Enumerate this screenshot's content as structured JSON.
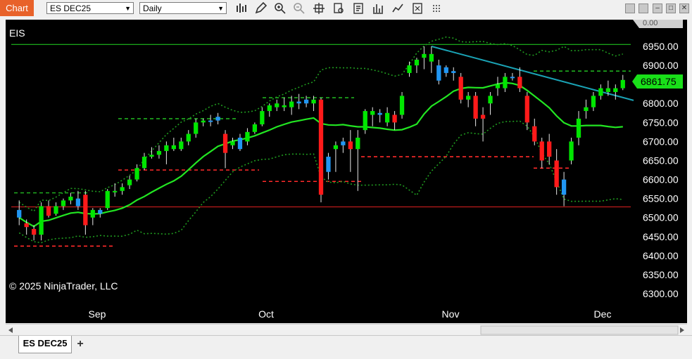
{
  "toolbar": {
    "chart_label": "Chart",
    "instrument": "ES DEC25",
    "period": "Daily"
  },
  "chart": {
    "symbol_label": "EIS",
    "copyright": "© 2025 NinjaTrader, LLC",
    "price_top": "0.00",
    "last_price": "6861.75",
    "y_ticks": [
      "6950.00",
      "6900.00",
      "6850.00",
      "6800.00",
      "6750.00",
      "6700.00",
      "6650.00",
      "6600.00",
      "6550.00",
      "6500.00",
      "6450.00",
      "6400.00",
      "6350.00",
      "6300.00"
    ],
    "x_ticks": [
      "Sep",
      "Oct",
      "Nov",
      "Dec"
    ],
    "colors": {
      "up": "#00e600",
      "down": "#ff1a1a",
      "neutral": "#2196f3",
      "ma": "#22e622",
      "band": "#1f9a1f",
      "trend": "#1aa3b5"
    }
  },
  "chart_data": {
    "type": "candlestick",
    "x_tick_labels": [
      "Sep",
      "Oct",
      "Nov",
      "Dec"
    ],
    "y_range": [
      6275,
      6985
    ],
    "last_price": 6861.75,
    "candles": [
      [
        6520,
        6545,
        6480,
        6500,
        "blue"
      ],
      [
        6485,
        6495,
        6455,
        6475,
        "red"
      ],
      [
        6470,
        6480,
        6440,
        6455,
        "red"
      ],
      [
        6455,
        6540,
        6440,
        6530,
        "green"
      ],
      [
        6530,
        6545,
        6500,
        6505,
        "red"
      ],
      [
        6510,
        6540,
        6505,
        6530,
        "green"
      ],
      [
        6530,
        6550,
        6520,
        6545,
        "green"
      ],
      [
        6545,
        6565,
        6535,
        6555,
        "green"
      ],
      [
        6550,
        6570,
        6520,
        6530,
        "blue"
      ],
      [
        6560,
        6570,
        6455,
        6480,
        "red"
      ],
      [
        6520,
        6525,
        6480,
        6500,
        "green"
      ],
      [
        6510,
        6525,
        6500,
        6520,
        "blue"
      ],
      [
        6525,
        6575,
        6520,
        6570,
        "green"
      ],
      [
        6570,
        6590,
        6555,
        6570,
        "green"
      ],
      [
        6570,
        6590,
        6560,
        6580,
        "green"
      ],
      [
        6585,
        6610,
        6575,
        6600,
        "green"
      ],
      [
        6600,
        6640,
        6595,
        6630,
        "green"
      ],
      [
        6630,
        6670,
        6625,
        6660,
        "green"
      ],
      [
        6660,
        6685,
        6655,
        6665,
        "green"
      ],
      [
        6665,
        6690,
        6655,
        6675,
        "green"
      ],
      [
        6675,
        6700,
        6640,
        6690,
        "green"
      ],
      [
        6690,
        6710,
        6675,
        6680,
        "green"
      ],
      [
        6680,
        6710,
        6675,
        6700,
        "green"
      ],
      [
        6700,
        6730,
        6690,
        6720,
        "green"
      ],
      [
        6720,
        6760,
        6710,
        6750,
        "green"
      ],
      [
        6750,
        6760,
        6740,
        6755,
        "green"
      ],
      [
        6755,
        6770,
        6740,
        6755,
        "blue"
      ],
      [
        6755,
        6775,
        6745,
        6765,
        "blue"
      ],
      [
        6720,
        6730,
        6630,
        6670,
        "red"
      ],
      [
        6690,
        6710,
        6680,
        6700,
        "green"
      ],
      [
        6710,
        6720,
        6675,
        6680,
        "blue"
      ],
      [
        6700,
        6735,
        6690,
        6725,
        "green"
      ],
      [
        6725,
        6750,
        6720,
        6745,
        "green"
      ],
      [
        6745,
        6790,
        6740,
        6780,
        "green"
      ],
      [
        6780,
        6800,
        6765,
        6795,
        "green"
      ],
      [
        6790,
        6810,
        6780,
        6800,
        "green"
      ],
      [
        6795,
        6815,
        6780,
        6790,
        "green"
      ],
      [
        6790,
        6820,
        6770,
        6805,
        "green"
      ],
      [
        6805,
        6825,
        6785,
        6800,
        "blue"
      ],
      [
        6800,
        6820,
        6790,
        6810,
        "blue"
      ],
      [
        6810,
        6820,
        6780,
        6800,
        "green"
      ],
      [
        6810,
        6815,
        6540,
        6560,
        "red"
      ],
      [
        6660,
        6670,
        6600,
        6620,
        "blue"
      ],
      [
        6680,
        6700,
        6620,
        6690,
        "green"
      ],
      [
        6690,
        6710,
        6670,
        6700,
        "blue"
      ],
      [
        6700,
        6730,
        6620,
        6680,
        "red"
      ],
      [
        6680,
        6730,
        6570,
        6710,
        "green"
      ],
      [
        6730,
        6785,
        6720,
        6780,
        "green"
      ],
      [
        6780,
        6790,
        6740,
        6770,
        "green"
      ],
      [
        6770,
        6785,
        6750,
        6775,
        "blue"
      ],
      [
        6775,
        6790,
        6740,
        6750,
        "green"
      ],
      [
        6750,
        6780,
        6730,
        6770,
        "red"
      ],
      [
        6770,
        6830,
        6760,
        6820,
        "green"
      ],
      [
        6880,
        6910,
        6870,
        6900,
        "green"
      ],
      [
        6900,
        6920,
        6880,
        6915,
        "green"
      ],
      [
        6920,
        6950,
        6890,
        6930,
        "green"
      ],
      [
        6930,
        6950,
        6880,
        6910,
        "green"
      ],
      [
        6900,
        6915,
        6850,
        6860,
        "blue"
      ],
      [
        6895,
        6900,
        6870,
        6880,
        "blue"
      ],
      [
        6885,
        6895,
        6860,
        6880,
        "blue"
      ],
      [
        6870,
        6880,
        6800,
        6810,
        "red"
      ],
      [
        6810,
        6830,
        6790,
        6820,
        "green"
      ],
      [
        6820,
        6830,
        6740,
        6760,
        "red"
      ],
      [
        6760,
        6790,
        6700,
        6770,
        "red"
      ],
      [
        6800,
        6830,
        6770,
        6820,
        "green"
      ],
      [
        6850,
        6870,
        6820,
        6840,
        "green"
      ],
      [
        6840,
        6880,
        6830,
        6870,
        "green"
      ],
      [
        6870,
        6880,
        6860,
        6870,
        "blue"
      ],
      [
        6870,
        6895,
        6830,
        6840,
        "red"
      ],
      [
        6820,
        6830,
        6730,
        6750,
        "red"
      ],
      [
        6740,
        6760,
        6690,
        6700,
        "red"
      ],
      [
        6700,
        6710,
        6630,
        6650,
        "red"
      ],
      [
        6700,
        6720,
        6640,
        6660,
        "red"
      ],
      [
        6650,
        6680,
        6560,
        6580,
        "red"
      ],
      [
        6600,
        6620,
        6530,
        6560,
        "blue"
      ],
      [
        6650,
        6710,
        6640,
        6700,
        "green"
      ],
      [
        6710,
        6780,
        6690,
        6760,
        "green"
      ],
      [
        6780,
        6810,
        6760,
        6790,
        "green"
      ],
      [
        6790,
        6830,
        6780,
        6820,
        "green"
      ],
      [
        6820,
        6850,
        6810,
        6840,
        "green"
      ],
      [
        6840,
        6860,
        6820,
        6830,
        "green"
      ],
      [
        6830,
        6850,
        6810,
        6840,
        "green"
      ],
      [
        6840,
        6875,
        6835,
        6861.75,
        "green"
      ]
    ]
  }
}
